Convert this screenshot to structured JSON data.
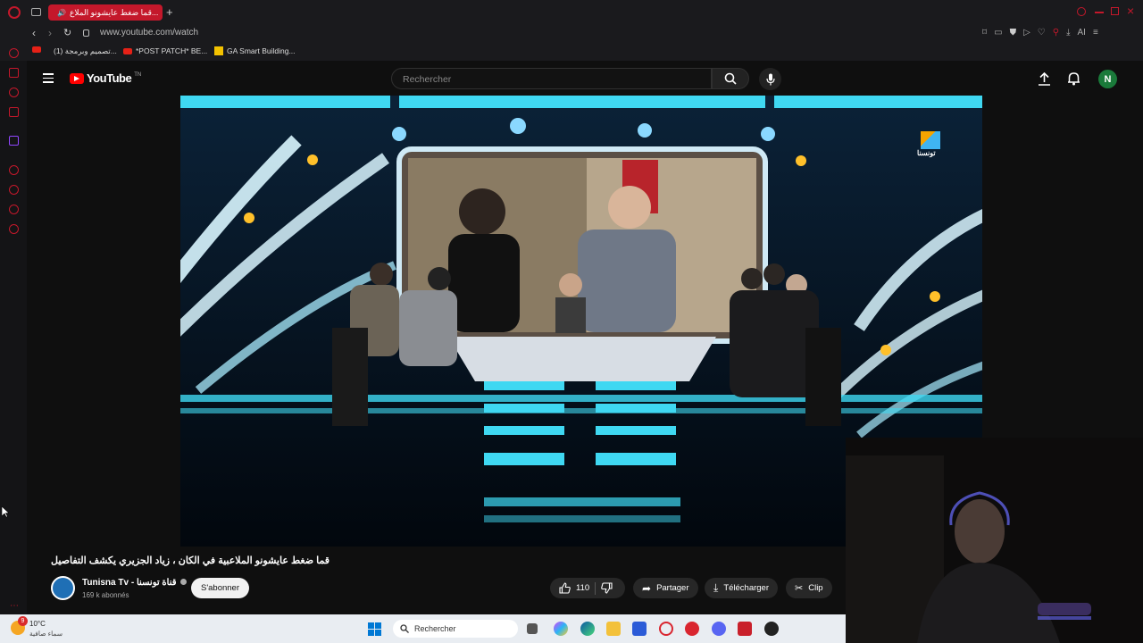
{
  "browser": {
    "active_tab_title": "قما ضغط عايشونو الملاع...",
    "url": "www.youtube.com/watch",
    "bookmarks": [
      "(1) تصميم وبرمجة...",
      "*POST PATCH* BE...",
      "GA Smart Building..."
    ]
  },
  "youtube": {
    "logo_text": "YouTube",
    "logo_suffix": "TN",
    "search_placeholder": "Rechercher",
    "avatar_letter": "N"
  },
  "video": {
    "channel_logo_text": "تونسنا",
    "title": "قما ضغط عايشونو الملاعبية في الكان ، زياد الجزيري يكشف التفاصيل",
    "channel_name": "Tunisna Tv - قناة تونسنا",
    "subscribers": "169 k abonnés",
    "subscribe_label": "S'abonner",
    "likes": "110",
    "share_label": "Partager",
    "download_label": "Télécharger",
    "clip_label": "Clip"
  },
  "taskbar": {
    "temperature": "10°C",
    "weather_desc": "سماء صافية",
    "weather_badge": "9",
    "search_label": "Rechercher"
  },
  "colors": {
    "brand_red": "#e62117",
    "opera_red": "#c4182b",
    "stage_cyan": "#3fd8f2"
  }
}
